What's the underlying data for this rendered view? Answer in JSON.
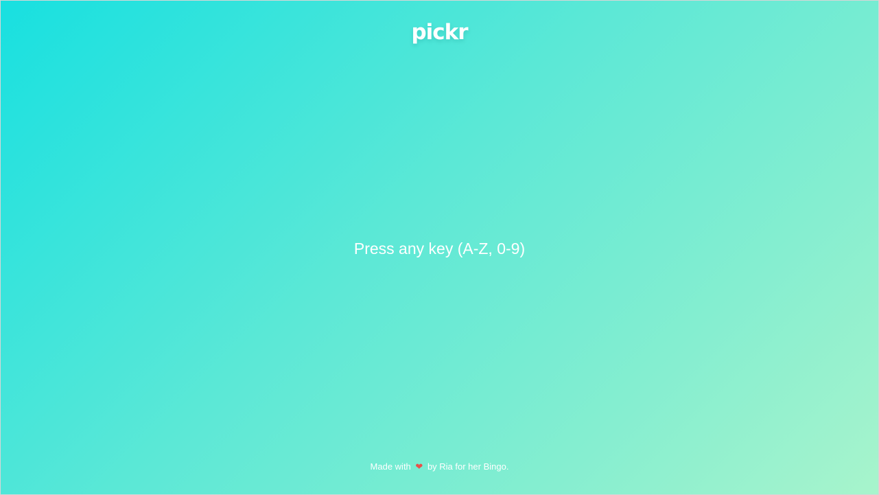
{
  "app": {
    "logo_text": "Pickr"
  },
  "main": {
    "prompt": "Press any key (A-Z, 0-9)"
  },
  "footer": {
    "prefix": "Made with",
    "heart_icon": "heart-icon",
    "suffix": "by Ria for her Bingo."
  },
  "colors": {
    "gradient_start": "#18e0e0",
    "gradient_end": "#a8f4cc",
    "text": "#ffffff",
    "heart": "#e8504a"
  }
}
